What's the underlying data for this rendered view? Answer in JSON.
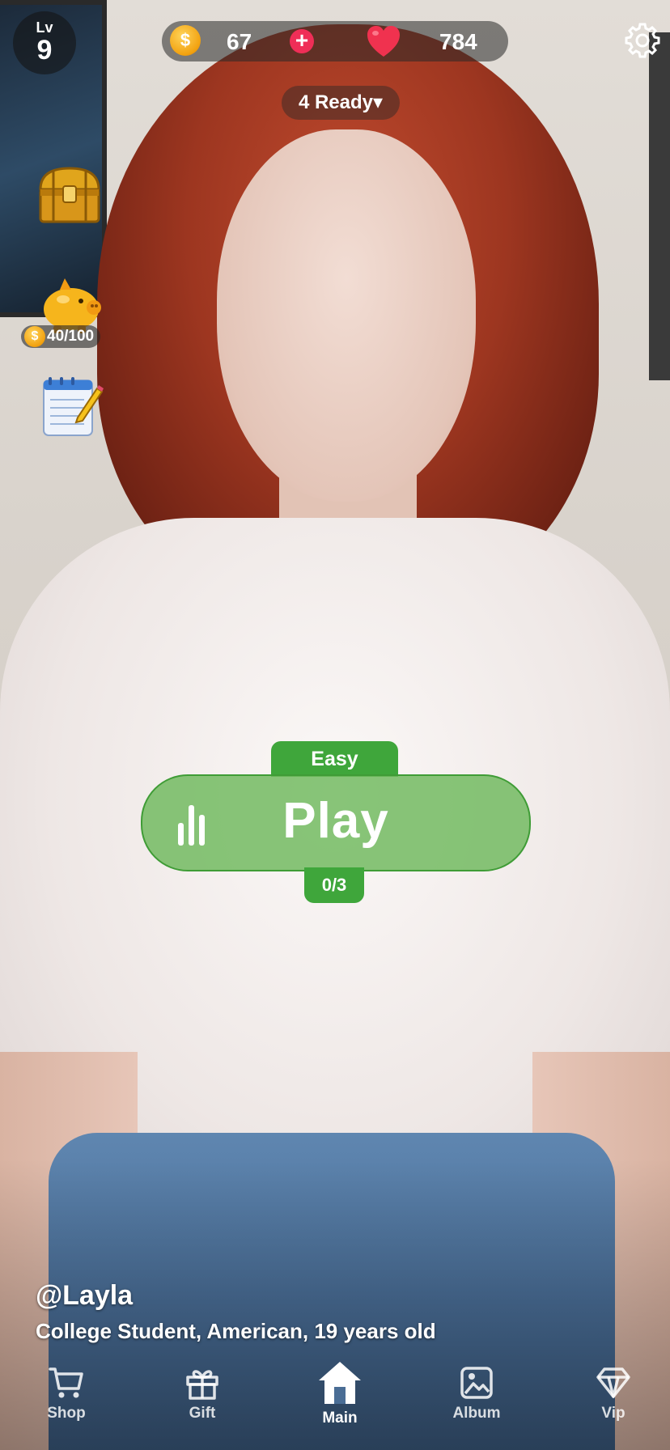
{
  "header": {
    "level_label": "Lv",
    "level_value": "9",
    "coins": "67",
    "coin_symbol": "$",
    "hearts": "784",
    "ready_label": "4 Ready▾"
  },
  "sidebar": {
    "piggy_progress_text": "40/100",
    "piggy_progress_fraction": 0.4
  },
  "game": {
    "difficulty": "Easy",
    "play_label": "Play",
    "progress": "0/3"
  },
  "character": {
    "name": "@Layla",
    "description": "College Student, American, 19 years old"
  },
  "nav": {
    "items": [
      {
        "label": "Shop",
        "icon": "cart-icon"
      },
      {
        "label": "Gift",
        "icon": "gift-icon"
      },
      {
        "label": "Main",
        "icon": "home-icon",
        "active": true
      },
      {
        "label": "Album",
        "icon": "album-icon"
      },
      {
        "label": "Vip",
        "icon": "diamond-icon"
      }
    ]
  },
  "colors": {
    "accent_green": "#3fa63b",
    "play_green": "#6eb85c",
    "plus_red": "#ef2e57",
    "heart_red": "#f0324f",
    "coin_gold": "#f2a10f"
  }
}
